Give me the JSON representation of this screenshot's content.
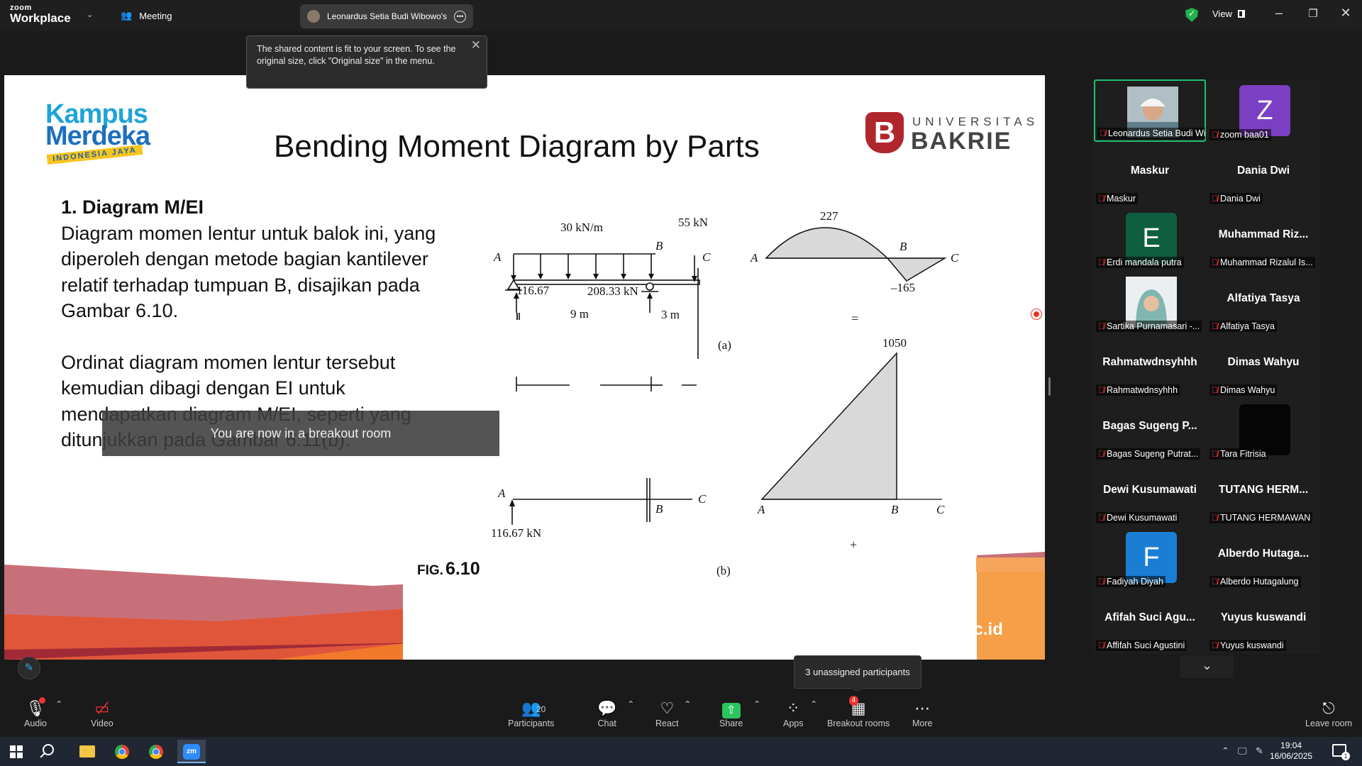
{
  "app": {
    "brand_top": "zoom",
    "brand_bottom": "Workplace",
    "meeting_label": "Meeting",
    "share_tab": "Leonardus Setia Budi Wibowo's screen",
    "view_label": "View"
  },
  "toast": {
    "text": "The shared content is fit to your screen. To see the original size, click \"Original size\" in the menu."
  },
  "breakout_banner": "You are now in a breakout room",
  "slide": {
    "title": "Bending Moment Diagram by Parts",
    "logo_left": [
      "Kampus",
      "Merdeka"
    ],
    "logo_left_badge": "INDONESIA JAYA",
    "logo_right_top": "UNIVERSITAS",
    "logo_right_bottom": "BAKRIE",
    "logo_right_mark": "B",
    "heading": "1. Diagram M/EI",
    "para1": "Diagram momen lentur untuk balok ini, yang diperoleh dengan metode bagian kantilever relatif terhadap tumpuan B, disajikan pada Gambar 6.10.",
    "para2": "Ordinat diagram momen lentur tersebut kemudian dibagi dengan EI untuk mendapatkan diagram M/EI, seperti yang ditunjukkan pada Gambar 6.11(b).",
    "url": "www.bakrie.ac.id",
    "figure": {
      "load_dist": "30 kN/m",
      "load_point": "55 kN",
      "node_a": "A",
      "node_b": "B",
      "node_c": "C",
      "reaction_a": "116.67",
      "reaction_b": "208.33 kN",
      "span_ab": "9 m",
      "span_bc": "3 m",
      "caption_a": "(a)",
      "moment_max": "227",
      "moment_min": "–165",
      "equals": "=",
      "moment_b_max": "1050",
      "reaction_a_b": "116.67 kN",
      "plus": "+",
      "fig_label": "FIG.",
      "fig_number": "6.10",
      "caption_b": "(b)"
    }
  },
  "gallery": [
    {
      "title": "",
      "label": "Leonardus Setia Budi Wi...",
      "pic": "photo-man",
      "color": "#cfd8dc",
      "active": true
    },
    {
      "title": "",
      "label": "zoom baa01",
      "pic": "Z",
      "color": "#7b3fc4"
    },
    {
      "title": "Maskur",
      "label": "Maskur"
    },
    {
      "title": "Dania Dwi",
      "label": "Dania Dwi"
    },
    {
      "title": "",
      "label": "Erdi mandala putra",
      "pic": "E",
      "color": "#0e5e3f"
    },
    {
      "title": "Muhammad  Riz...",
      "label": "Muhammad Rizalul Is..."
    },
    {
      "title": "",
      "label": "Sartika Purnamasari -...",
      "pic": "photo-woman",
      "color": "#e8ecef"
    },
    {
      "title": "Alfatiya Tasya",
      "label": "Alfatiya Tasya"
    },
    {
      "title": "Rahmatwdnsyhhh",
      "label": "Rahmatwdnsyhhh"
    },
    {
      "title": "Dimas Wahyu",
      "label": "Dimas Wahyu"
    },
    {
      "title": "Bagas Sugeng P...",
      "label": "Bagas Sugeng Putrat..."
    },
    {
      "title": "",
      "label": "Tara Fitrisia",
      "pic": "dark",
      "color": "#050505"
    },
    {
      "title": "Dewi Kusumawati",
      "label": "Dewi Kusumawati"
    },
    {
      "title": "TUTANG  HERM...",
      "label": "TUTANG HERMAWAN"
    },
    {
      "title": "",
      "label": "Fadiyah Diyah",
      "pic": "F",
      "color": "#1a7fd4"
    },
    {
      "title": "Alberdo  Hutaga...",
      "label": "Alberdo Hutagalung"
    },
    {
      "title": "Afifah  Suci  Agu...",
      "label": "Affifah Suci Agustini"
    },
    {
      "title": "Yuyus kuswandi",
      "label": "Yuyus kuswandi"
    }
  ],
  "unassigned_tooltip": "3 unassigned participants",
  "toolbar": {
    "audio": "Audio",
    "video": "Video",
    "participants": "Participants",
    "participants_count": "20",
    "chat": "Chat",
    "react": "React",
    "share": "Share",
    "apps": "Apps",
    "breakout": "Breakout rooms",
    "breakout_badge": "4",
    "more": "More",
    "leave": "Leave room"
  },
  "taskbar": {
    "time": "19:04",
    "date": "16/06/2025",
    "notif_count": "1"
  },
  "colors": {
    "accent_green": "#1fc06f",
    "mic_off": "#e33333",
    "share_green": "#2bc45e",
    "kampus_blue": "#1fa4d9",
    "bakrie_red": "#b1262d"
  }
}
